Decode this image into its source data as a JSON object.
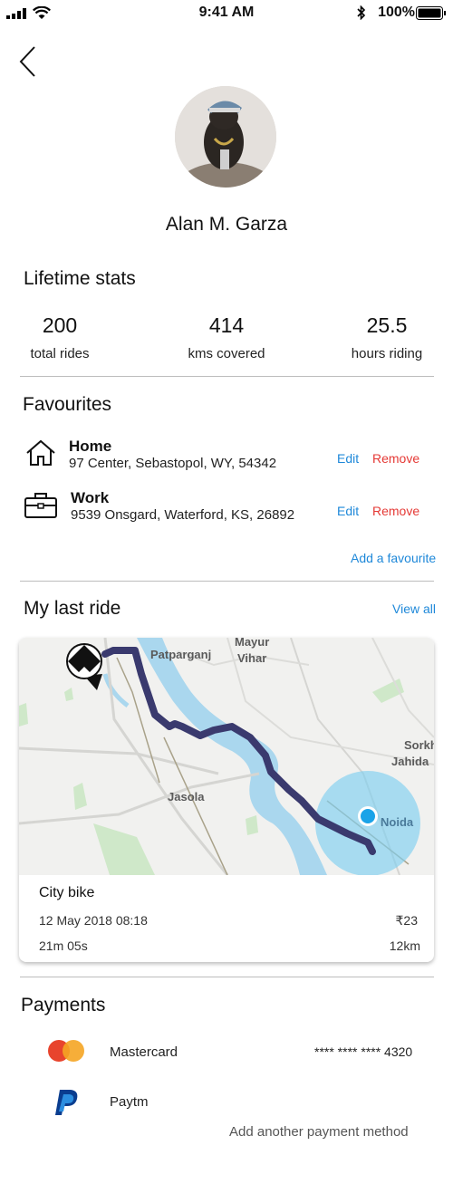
{
  "status_bar": {
    "time": "9:41 AM",
    "battery": "100%"
  },
  "profile": {
    "name": "Alan M. Garza"
  },
  "lifetime_stats": {
    "title": "Lifetime stats",
    "items": [
      {
        "value": "200",
        "label": "total rides"
      },
      {
        "value": "414",
        "label": "kms covered"
      },
      {
        "value": "25.5",
        "label": "hours riding"
      }
    ]
  },
  "favourites": {
    "title": "Favourites",
    "items": [
      {
        "name": "Home",
        "address": "97 Center, Sebastopol, WY, 54342",
        "edit": "Edit",
        "remove": "Remove"
      },
      {
        "name": "Work",
        "address": "9539 Onsgard, Waterford, KS, 26892",
        "edit": "Edit",
        "remove": "Remove"
      }
    ],
    "add_label": "Add a favourite"
  },
  "last_ride": {
    "title": "My last ride",
    "view_all": "View all",
    "map_labels": [
      "Mayur",
      "Vihar",
      "Patparganj",
      "Sorkh",
      "Jahida",
      "Jasola",
      "Noida"
    ],
    "bike": "City bike",
    "date": "12 May 2018 08:18",
    "price": "₹23",
    "duration": "21m 05s",
    "distance": "12km"
  },
  "payments": {
    "title": "Payments",
    "methods": [
      {
        "name": "Mastercard",
        "detail": "**** **** **** 4320"
      },
      {
        "name": "Paytm",
        "detail": ""
      }
    ],
    "add_label": "Add another payment method"
  },
  "colors": {
    "link": "#1e88d9",
    "remove": "#e53935",
    "route": "#3a3a6e",
    "location": "#1aa3e8"
  }
}
